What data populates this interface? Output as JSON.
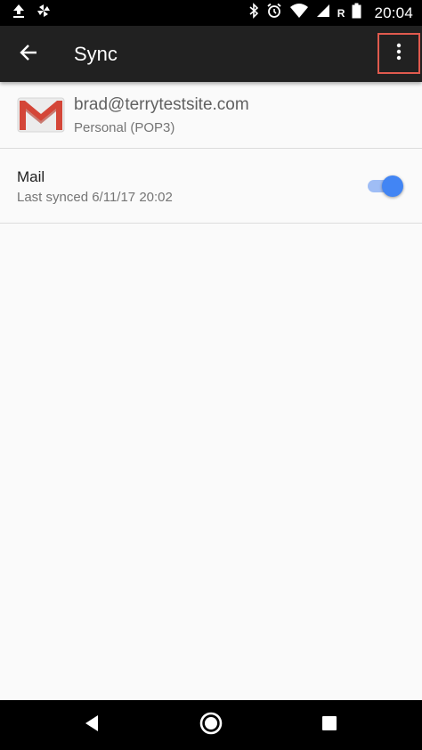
{
  "status_bar": {
    "time": "20:04",
    "roaming_label": "R",
    "icons": [
      "upload-icon",
      "pinwheel-icon",
      "bluetooth-icon",
      "alarm-icon",
      "wifi-icon",
      "signal-icon",
      "battery-icon"
    ]
  },
  "app_bar": {
    "title": "Sync",
    "icons": [
      "back-arrow-icon",
      "more-vert-icon"
    ]
  },
  "account": {
    "email": "brad@terrytestsite.com",
    "type": "Personal (POP3)",
    "logo": "gmail-logo-icon"
  },
  "sync_items": [
    {
      "title": "Mail",
      "subtitle": "Last synced 6/11/17 20:02",
      "enabled": true
    }
  ],
  "colors": {
    "app_bar": "#212121",
    "status_bar": "#000000",
    "toggle_on": "#4285f4",
    "toggle_track_on": "#9fbdf5",
    "highlight_border": "#e05a4e",
    "gmail_red": "#d44638"
  },
  "nav_bar": {
    "icons": [
      "nav-back-icon",
      "nav-home-icon",
      "nav-recents-icon"
    ]
  }
}
